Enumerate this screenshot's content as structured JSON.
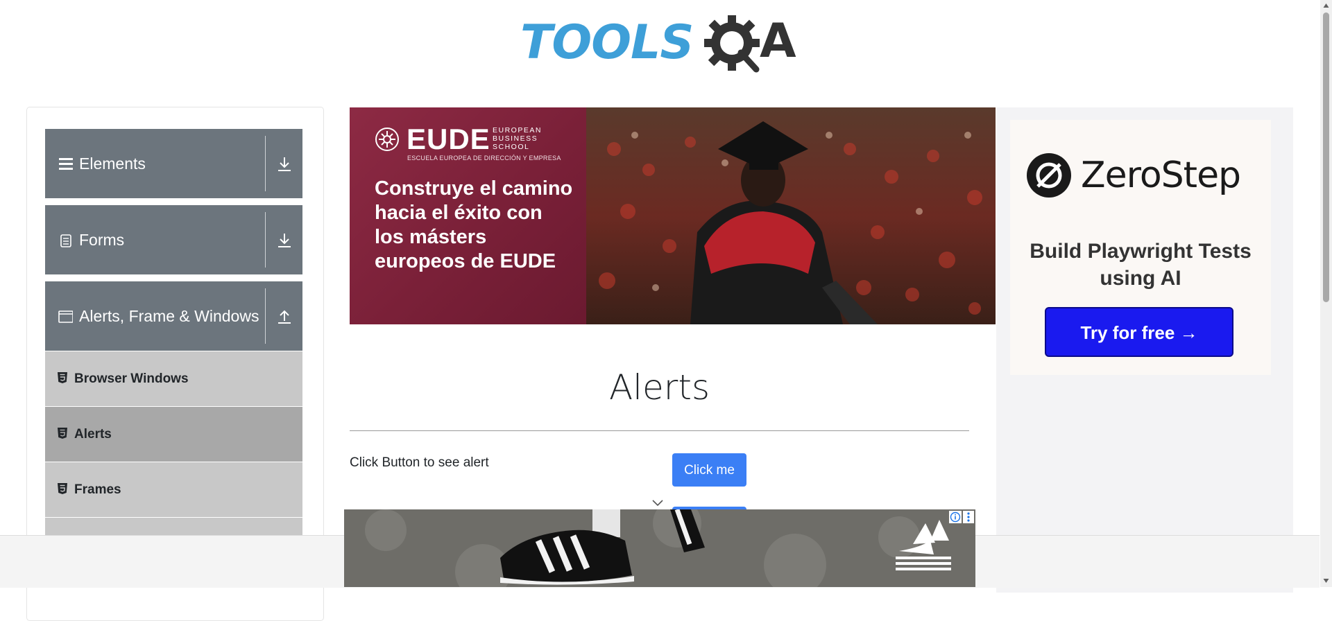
{
  "header": {
    "logo_text": "TOOLS",
    "logo_a": "A"
  },
  "sidebar": {
    "groups": [
      {
        "label": "Elements",
        "icon": "hamburger-icon",
        "arrow": "download-arrow-icon"
      },
      {
        "label": "Forms",
        "icon": "document-icon",
        "arrow": "download-arrow-icon"
      },
      {
        "label": "Alerts, Frame & Windows",
        "icon": "window-icon",
        "arrow": "upload-arrow-icon"
      }
    ],
    "items": [
      {
        "label": "Browser Windows",
        "active": false
      },
      {
        "label": "Alerts",
        "active": true
      },
      {
        "label": "Frames",
        "active": false
      }
    ]
  },
  "top_ad": {
    "brand": "EUDE",
    "brand_sub": "EUROPEAN BUSINESS SCHOOL",
    "brand_sub2": "ESCUELA EUROPEA DE DIRECCIÓN Y EMPRESA",
    "headline": "Construye el camino hacia el éxito con los másters europeos de EUDE"
  },
  "right_ad": {
    "brand": "ZeroStep",
    "tagline": "Build Playwright Tests using AI",
    "cta": "Try for free →"
  },
  "main": {
    "title": "Alerts",
    "rows": [
      {
        "label": "Click Button to see alert",
        "button": "Click me"
      }
    ]
  },
  "colors": {
    "sidebar_header": "#6c757d",
    "sidebar_item": "#c8c8c8",
    "sidebar_item_active": "#a8a8a8",
    "primary_button": "#3b7ff5",
    "logo_blue": "#3e9fd8",
    "zerostep_button": "#1a1aef"
  }
}
